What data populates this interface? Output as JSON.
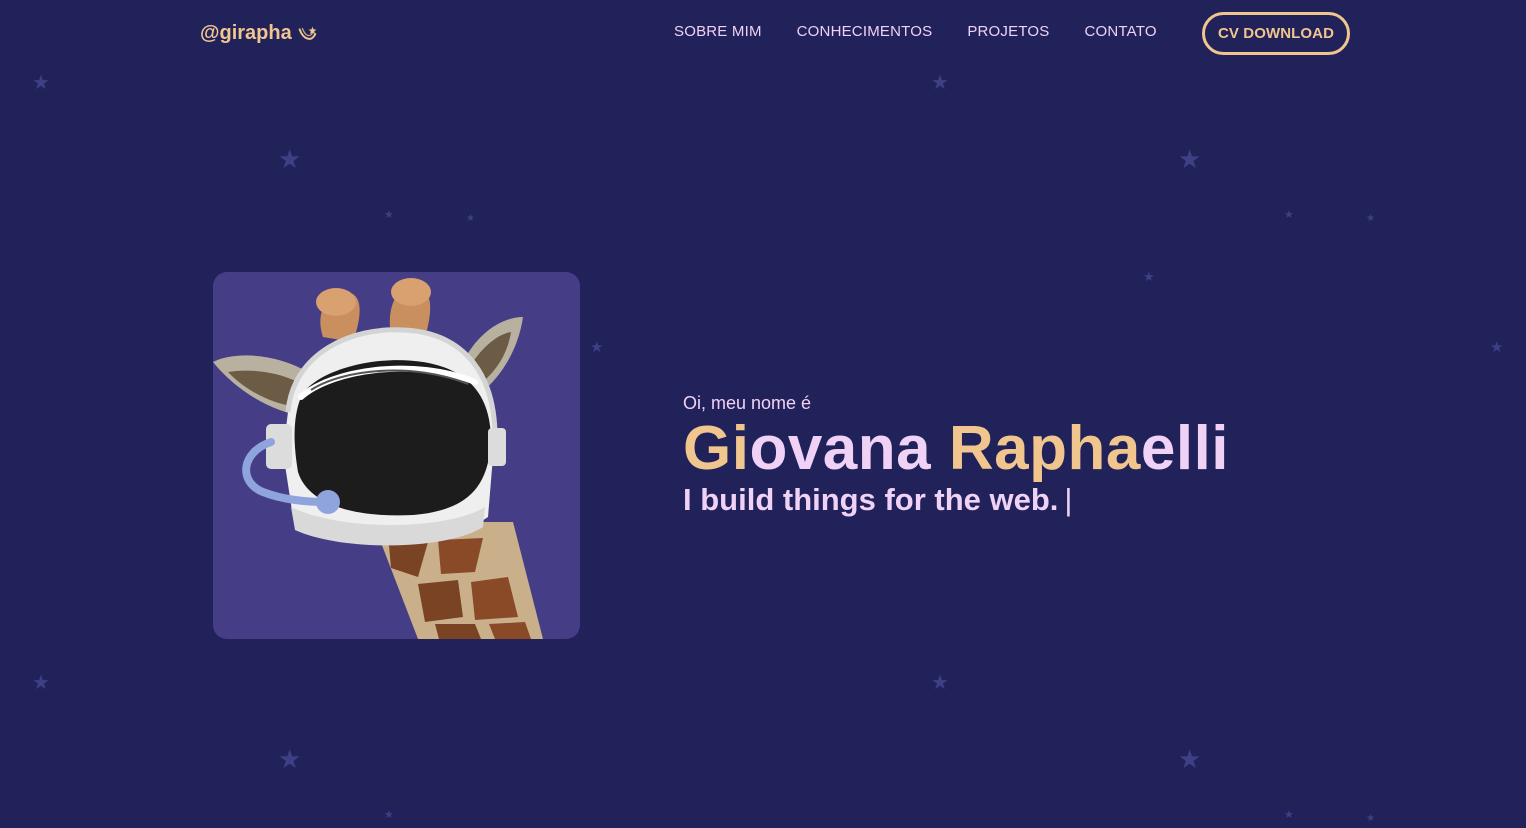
{
  "brand": {
    "handle": "@girapha",
    "icon": "shooting-star-icon"
  },
  "nav": {
    "items": [
      {
        "label": "SOBRE MIM"
      },
      {
        "label": "CONHECIMENTOS"
      },
      {
        "label": "PROJETOS"
      },
      {
        "label": "CONTATO"
      }
    ],
    "cv_button": "CV DOWNLOAD"
  },
  "hero": {
    "greeting": "Oi, meu nome é",
    "first_name": "Giovana",
    "last_name_part1": "Rapha",
    "last_name_part2": "elli",
    "tagline": "I build things for the web.",
    "cursor": "|",
    "image": "giraffe-astronaut-helmet-illustration"
  },
  "colors": {
    "background": "#21225a",
    "accent_gold": "#f1c58e",
    "accent_pink": "#efd2f5",
    "card": "#453d85",
    "star": "#3f3f86"
  }
}
